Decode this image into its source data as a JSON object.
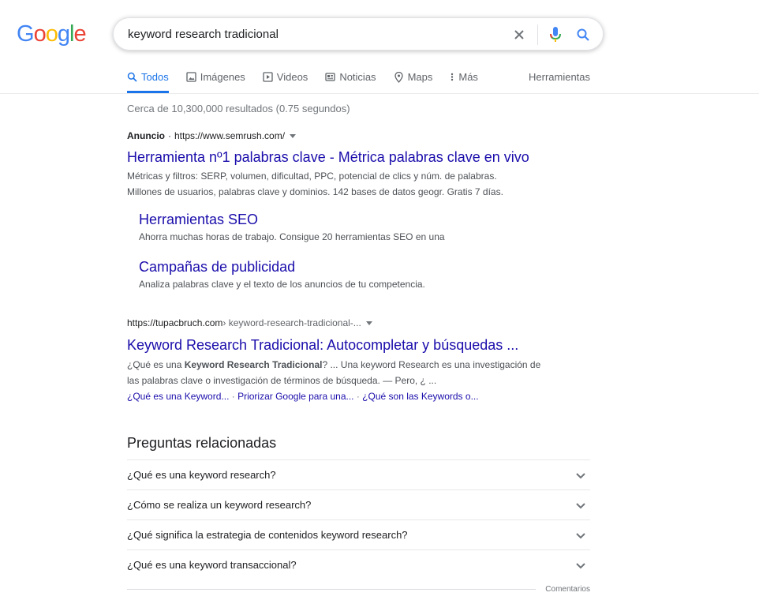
{
  "logo": "Google",
  "search": {
    "query": "keyword research tradicional"
  },
  "tabs": [
    {
      "label": "Todos",
      "icon": "search-icon"
    },
    {
      "label": "Imágenes",
      "icon": "image-icon"
    },
    {
      "label": "Videos",
      "icon": "video-icon"
    },
    {
      "label": "Noticias",
      "icon": "news-icon"
    },
    {
      "label": "Maps",
      "icon": "map-pin-icon"
    },
    {
      "label": "Más",
      "icon": "more-vert-icon"
    }
  ],
  "tools_label": "Herramientas",
  "stats": "Cerca de 10,300,000 resultados (0.75 segundos)",
  "ad": {
    "label": "Anuncio",
    "sep": "·",
    "url": "https://www.semrush.com/",
    "title": "Herramienta nº1 palabras clave - Métrica palabras clave en vivo",
    "desc1": "Métricas y filtros: SERP, volumen, dificultad, PPC, potencial de clics y núm. de palabras.",
    "desc2": "Millones de usuarios, palabras clave y dominios. 142 bases de datos geogr. Gratis 7 días.",
    "sitelinks": [
      {
        "title": "Herramientas SEO",
        "desc": "Ahorra muchas horas de trabajo. Consigue 20 herramientas SEO en una"
      },
      {
        "title": "Campañas de publicidad",
        "desc": "Analiza palabras clave y el texto de los anuncios de tu competencia."
      }
    ]
  },
  "organic": {
    "domain": "https://tupacbruch.com",
    "path": " › keyword-research-tradicional-...",
    "title": "Keyword Research Tradicional: Autocompletar y búsquedas ...",
    "desc_a": "¿Qué es una ",
    "desc_bold": "Keyword Research Tradicional",
    "desc_b": "? ... Una keyword Research es una investigación de las palabras clave o investigación de términos de búsqueda. — Pero, ¿ ...",
    "links": [
      "¿Qué es una Keyword...",
      "Priorizar Google para una...",
      "¿Qué son las Keywords o..."
    ],
    "link_sep": " · "
  },
  "related": {
    "title": "Preguntas relacionadas",
    "questions": [
      "¿Qué es una keyword research?",
      "¿Cómo se realiza un keyword research?",
      "¿Qué significa la estrategia de contenidos keyword research?",
      "¿Qué es una keyword transaccional?"
    ],
    "feedback": "Comentarios"
  },
  "colors": {
    "link": "#1a0dab",
    "active_tab": "#1a73e8",
    "logo": [
      "#4285f4",
      "#ea4335",
      "#fbbc05",
      "#4285f4",
      "#34a853",
      "#ea4335"
    ]
  }
}
